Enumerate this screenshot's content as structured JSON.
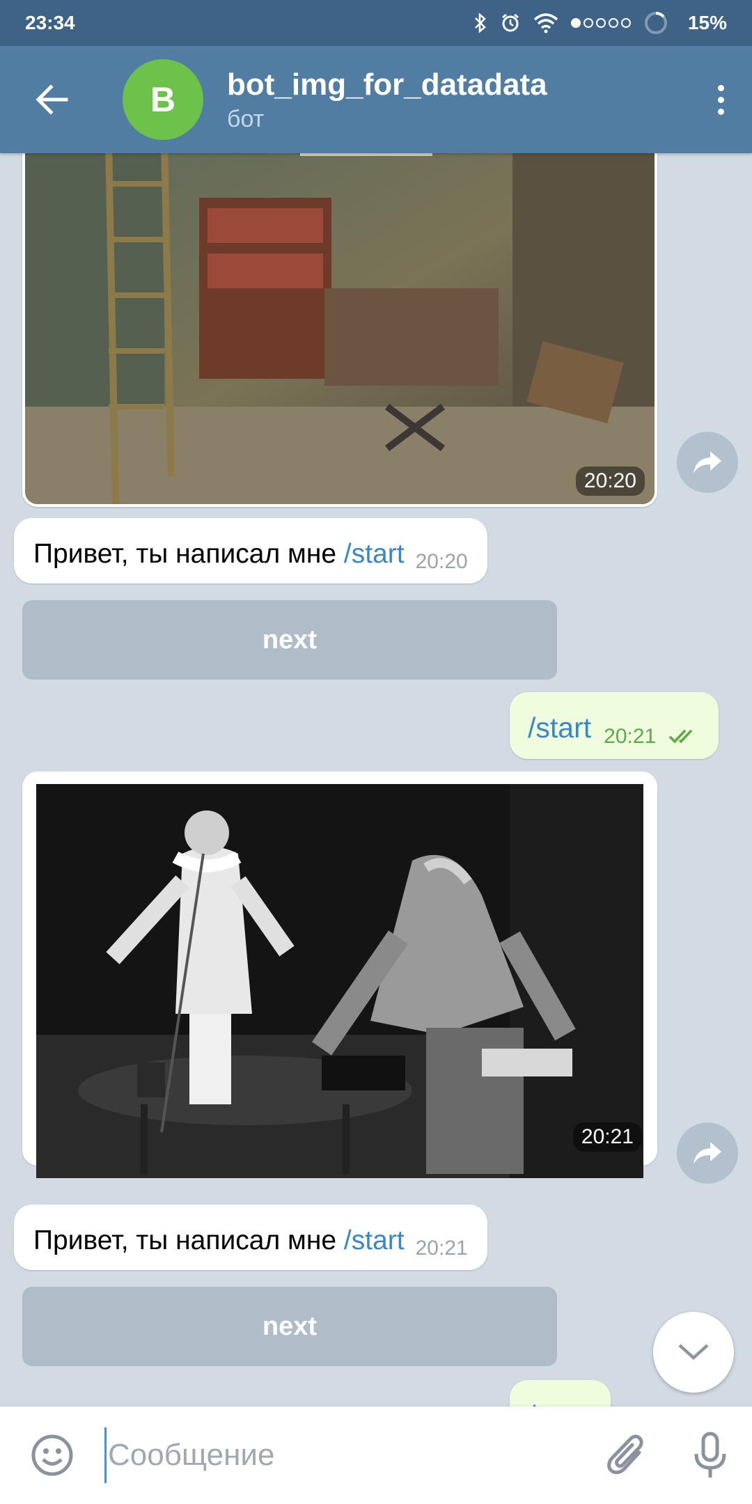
{
  "status_bar": {
    "time": "23:34",
    "battery": "15%"
  },
  "header": {
    "avatar_letter": "B",
    "title": "bot_img_for_datadata",
    "subtitle": "бот",
    "avatar_color": "#6cc24a"
  },
  "messages": [
    {
      "type": "photo",
      "time": "20:20",
      "description_icon": "photo-abandoned-room"
    },
    {
      "type": "text_in",
      "text": "Привет, ты написал мне ",
      "command": "/start",
      "time": "20:20"
    },
    {
      "type": "keyboard_button",
      "label": "next"
    },
    {
      "type": "text_out",
      "command": "/start",
      "time": "20:21"
    },
    {
      "type": "photo",
      "time": "20:21",
      "description_icon": "photo-performers"
    },
    {
      "type": "text_in",
      "text": "Привет, ты написал мне ",
      "command": "/start",
      "time": "20:21"
    },
    {
      "type": "keyboard_button",
      "label": "next"
    },
    {
      "type": "text_out",
      "command": "/start"
    }
  ],
  "input": {
    "placeholder": "Сообщение"
  },
  "colors": {
    "header": "#517da2",
    "status_bar": "#3f6387",
    "outgoing_bubble": "#effdde",
    "link": "#3a86c7"
  }
}
